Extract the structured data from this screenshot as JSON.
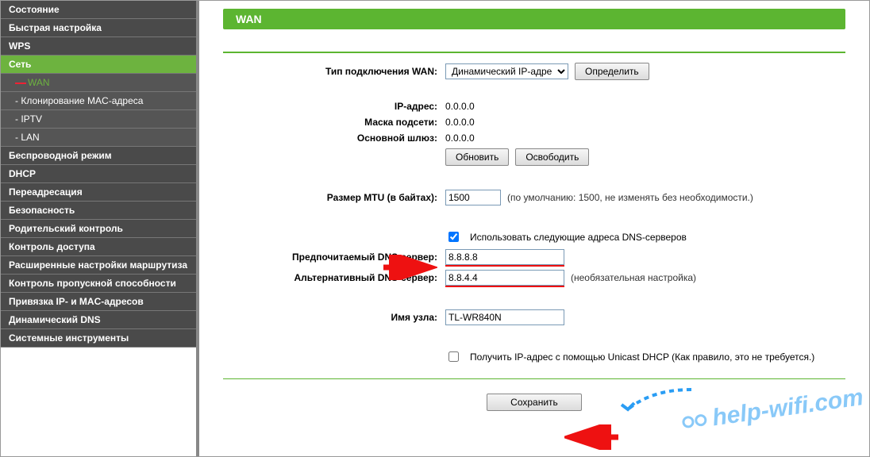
{
  "sidebar": {
    "items": [
      {
        "label": "Состояние"
      },
      {
        "label": "Быстрая настройка"
      },
      {
        "label": "WPS"
      },
      {
        "label": "Сеть"
      },
      {
        "label": "WAN"
      },
      {
        "label": "- Клонирование MAC-адреса"
      },
      {
        "label": "- IPTV"
      },
      {
        "label": "- LAN"
      },
      {
        "label": "Беспроводной режим"
      },
      {
        "label": "DHCP"
      },
      {
        "label": "Переадресация"
      },
      {
        "label": "Безопасность"
      },
      {
        "label": "Родительский контроль"
      },
      {
        "label": "Контроль доступа"
      },
      {
        "label": "Расширенные настройки маршрутиза"
      },
      {
        "label": "Контроль пропускной способности"
      },
      {
        "label": "Привязка IP- и MAC-адресов"
      },
      {
        "label": "Динамический DNS"
      },
      {
        "label": "Системные инструменты"
      }
    ]
  },
  "page": {
    "title": "WAN"
  },
  "labels": {
    "conn_type": "Тип подключения WAN:",
    "ip": "IP-адрес:",
    "mask": "Маска подсети:",
    "gateway": "Основной шлюз:",
    "mtu": "Размер MTU (в байтах):",
    "dns1": "Предпочитаемый DNS-сервер:",
    "dns2": "Альтернативный DNS-сервер:",
    "host": "Имя узла:"
  },
  "values": {
    "conn_type_selected": "Динамический IP-адрес",
    "ip": "0.0.0.0",
    "mask": "0.0.0.0",
    "gateway": "0.0.0.0",
    "mtu": "1500",
    "dns1": "8.8.8.8",
    "dns2": "8.8.4.4",
    "host": "TL-WR840N"
  },
  "hints": {
    "mtu": "(по умолчанию: 1500, не изменять без необходимости.)",
    "dns2": "(необязательная настройка)"
  },
  "checkboxes": {
    "use_dns": "Использовать следующие адреса DNS-серверов",
    "unicast": "Получить IP-адрес с помощью Unicast DHCP (Как правило, это не требуется.)"
  },
  "buttons": {
    "detect": "Определить",
    "renew": "Обновить",
    "release": "Освободить",
    "save": "Сохранить"
  },
  "watermark": "help-wifi.com"
}
